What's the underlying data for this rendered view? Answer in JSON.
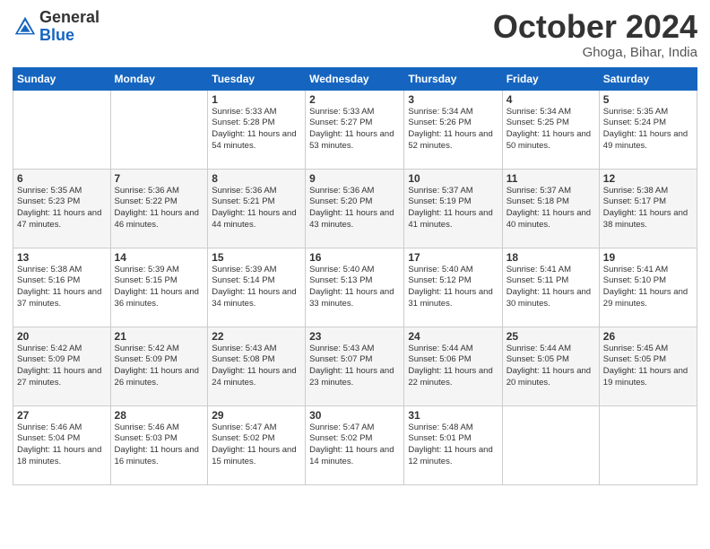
{
  "logo": {
    "general": "General",
    "blue": "Blue"
  },
  "header": {
    "month": "October 2024",
    "location": "Ghoga, Bihar, India"
  },
  "weekdays": [
    "Sunday",
    "Monday",
    "Tuesday",
    "Wednesday",
    "Thursday",
    "Friday",
    "Saturday"
  ],
  "weeks": [
    [
      {
        "day": "",
        "info": ""
      },
      {
        "day": "",
        "info": ""
      },
      {
        "day": "1",
        "info": "Sunrise: 5:33 AM\nSunset: 5:28 PM\nDaylight: 11 hours and 54 minutes."
      },
      {
        "day": "2",
        "info": "Sunrise: 5:33 AM\nSunset: 5:27 PM\nDaylight: 11 hours and 53 minutes."
      },
      {
        "day": "3",
        "info": "Sunrise: 5:34 AM\nSunset: 5:26 PM\nDaylight: 11 hours and 52 minutes."
      },
      {
        "day": "4",
        "info": "Sunrise: 5:34 AM\nSunset: 5:25 PM\nDaylight: 11 hours and 50 minutes."
      },
      {
        "day": "5",
        "info": "Sunrise: 5:35 AM\nSunset: 5:24 PM\nDaylight: 11 hours and 49 minutes."
      }
    ],
    [
      {
        "day": "6",
        "info": "Sunrise: 5:35 AM\nSunset: 5:23 PM\nDaylight: 11 hours and 47 minutes."
      },
      {
        "day": "7",
        "info": "Sunrise: 5:36 AM\nSunset: 5:22 PM\nDaylight: 11 hours and 46 minutes."
      },
      {
        "day": "8",
        "info": "Sunrise: 5:36 AM\nSunset: 5:21 PM\nDaylight: 11 hours and 44 minutes."
      },
      {
        "day": "9",
        "info": "Sunrise: 5:36 AM\nSunset: 5:20 PM\nDaylight: 11 hours and 43 minutes."
      },
      {
        "day": "10",
        "info": "Sunrise: 5:37 AM\nSunset: 5:19 PM\nDaylight: 11 hours and 41 minutes."
      },
      {
        "day": "11",
        "info": "Sunrise: 5:37 AM\nSunset: 5:18 PM\nDaylight: 11 hours and 40 minutes."
      },
      {
        "day": "12",
        "info": "Sunrise: 5:38 AM\nSunset: 5:17 PM\nDaylight: 11 hours and 38 minutes."
      }
    ],
    [
      {
        "day": "13",
        "info": "Sunrise: 5:38 AM\nSunset: 5:16 PM\nDaylight: 11 hours and 37 minutes."
      },
      {
        "day": "14",
        "info": "Sunrise: 5:39 AM\nSunset: 5:15 PM\nDaylight: 11 hours and 36 minutes."
      },
      {
        "day": "15",
        "info": "Sunrise: 5:39 AM\nSunset: 5:14 PM\nDaylight: 11 hours and 34 minutes."
      },
      {
        "day": "16",
        "info": "Sunrise: 5:40 AM\nSunset: 5:13 PM\nDaylight: 11 hours and 33 minutes."
      },
      {
        "day": "17",
        "info": "Sunrise: 5:40 AM\nSunset: 5:12 PM\nDaylight: 11 hours and 31 minutes."
      },
      {
        "day": "18",
        "info": "Sunrise: 5:41 AM\nSunset: 5:11 PM\nDaylight: 11 hours and 30 minutes."
      },
      {
        "day": "19",
        "info": "Sunrise: 5:41 AM\nSunset: 5:10 PM\nDaylight: 11 hours and 29 minutes."
      }
    ],
    [
      {
        "day": "20",
        "info": "Sunrise: 5:42 AM\nSunset: 5:09 PM\nDaylight: 11 hours and 27 minutes."
      },
      {
        "day": "21",
        "info": "Sunrise: 5:42 AM\nSunset: 5:09 PM\nDaylight: 11 hours and 26 minutes."
      },
      {
        "day": "22",
        "info": "Sunrise: 5:43 AM\nSunset: 5:08 PM\nDaylight: 11 hours and 24 minutes."
      },
      {
        "day": "23",
        "info": "Sunrise: 5:43 AM\nSunset: 5:07 PM\nDaylight: 11 hours and 23 minutes."
      },
      {
        "day": "24",
        "info": "Sunrise: 5:44 AM\nSunset: 5:06 PM\nDaylight: 11 hours and 22 minutes."
      },
      {
        "day": "25",
        "info": "Sunrise: 5:44 AM\nSunset: 5:05 PM\nDaylight: 11 hours and 20 minutes."
      },
      {
        "day": "26",
        "info": "Sunrise: 5:45 AM\nSunset: 5:05 PM\nDaylight: 11 hours and 19 minutes."
      }
    ],
    [
      {
        "day": "27",
        "info": "Sunrise: 5:46 AM\nSunset: 5:04 PM\nDaylight: 11 hours and 18 minutes."
      },
      {
        "day": "28",
        "info": "Sunrise: 5:46 AM\nSunset: 5:03 PM\nDaylight: 11 hours and 16 minutes."
      },
      {
        "day": "29",
        "info": "Sunrise: 5:47 AM\nSunset: 5:02 PM\nDaylight: 11 hours and 15 minutes."
      },
      {
        "day": "30",
        "info": "Sunrise: 5:47 AM\nSunset: 5:02 PM\nDaylight: 11 hours and 14 minutes."
      },
      {
        "day": "31",
        "info": "Sunrise: 5:48 AM\nSunset: 5:01 PM\nDaylight: 11 hours and 12 minutes."
      },
      {
        "day": "",
        "info": ""
      },
      {
        "day": "",
        "info": ""
      }
    ]
  ]
}
